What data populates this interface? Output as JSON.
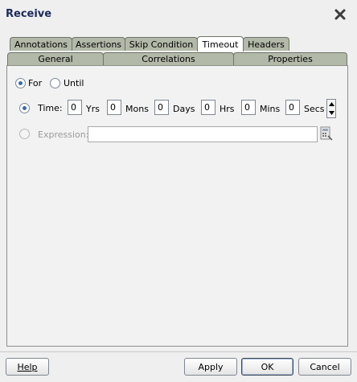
{
  "window": {
    "title": "Receive",
    "close_icon": "close-x-icon"
  },
  "tabs_row1": [
    {
      "label": "Annotations"
    },
    {
      "label": "Assertions"
    },
    {
      "label": "Skip Condition"
    },
    {
      "label": "Timeout",
      "active": true
    },
    {
      "label": "Headers"
    }
  ],
  "tabs_row2": [
    {
      "label": "General"
    },
    {
      "label": "Correlations"
    },
    {
      "label": "Properties"
    }
  ],
  "timeout": {
    "mode_for": "For",
    "mode_until": "Until",
    "selected_mode": "For",
    "time_label": "Time:",
    "fields": [
      {
        "value": "0",
        "unit": "Yrs"
      },
      {
        "value": "0",
        "unit": "Mons"
      },
      {
        "value": "0",
        "unit": "Days"
      },
      {
        "value": "0",
        "unit": "Hrs"
      },
      {
        "value": "0",
        "unit": "Mins"
      },
      {
        "value": "0",
        "unit": "Secs"
      }
    ],
    "expression_label": "Expression:",
    "expression_value": ""
  },
  "buttons": {
    "help": "Help",
    "apply": "Apply",
    "ok": "OK",
    "cancel": "Cancel"
  },
  "colors": {
    "tab_inactive": "#b3b9a9",
    "tab_active": "#ffffff",
    "title": "#1b2a5e",
    "radio_dot": "#3a67b8"
  }
}
